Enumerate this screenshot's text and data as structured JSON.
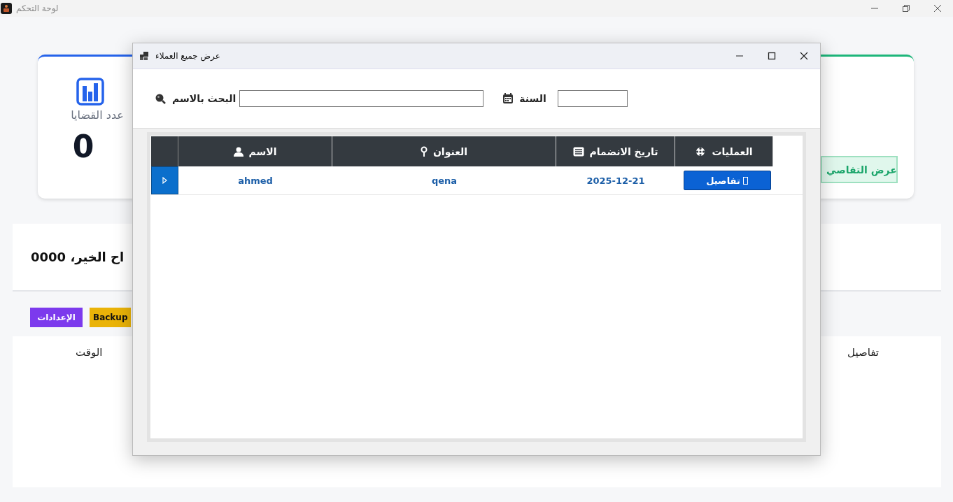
{
  "window": {
    "title": "لوحة التحكم"
  },
  "dashboard": {
    "cards": [
      {
        "kind": "stat",
        "color": "#2563eb",
        "label": "عدد القضايا",
        "value": "0"
      },
      {
        "kind": "action",
        "color": "#1db67a",
        "button": "عرض التفاصي"
      }
    ],
    "greeting": "اح الخير، 0000",
    "buttons": [
      {
        "label": "Backup",
        "color": "#eab308"
      },
      {
        "label": "الإعدادات",
        "color": "#7c3aed"
      }
    ],
    "table_columns": [
      "تفاصيل",
      "الوقت"
    ]
  },
  "dialog": {
    "title": "عرض جميع العملاء",
    "search_label": "البحث بالاسم",
    "year_label": "السنة",
    "table": {
      "columns": [
        {
          "kind": "actions",
          "label": "العمليات"
        },
        {
          "kind": "date",
          "label": "تاريخ الانضمام"
        },
        {
          "kind": "address",
          "label": "العنوان"
        },
        {
          "kind": "name",
          "label": "الاسم"
        }
      ],
      "rows": [
        {
          "selected": true,
          "name": "ahmed",
          "address": "qena",
          "date": "2025-12-21",
          "action": "تفاصيل"
        }
      ]
    }
  }
}
